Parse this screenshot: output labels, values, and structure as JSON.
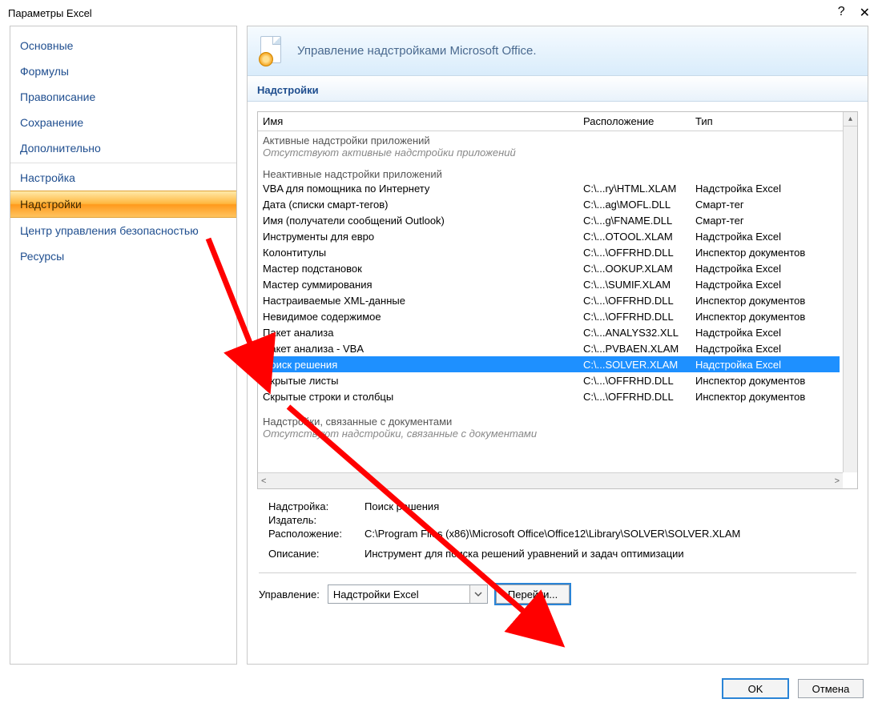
{
  "window": {
    "title": "Параметры Excel"
  },
  "sidebar": {
    "items": [
      {
        "label": "Основные"
      },
      {
        "label": "Формулы"
      },
      {
        "label": "Правописание"
      },
      {
        "label": "Сохранение"
      },
      {
        "label": "Дополнительно"
      }
    ],
    "items2": [
      {
        "label": "Настройка"
      },
      {
        "label": "Надстройки",
        "active": true
      },
      {
        "label": "Центр управления безопасностью"
      },
      {
        "label": "Ресурсы"
      }
    ]
  },
  "banner": {
    "title": "Управление надстройками Microsoft Office."
  },
  "section_title": "Надстройки",
  "columns": {
    "name": "Имя",
    "location": "Расположение",
    "type": "Тип"
  },
  "groups": {
    "active_header": "Активные надстройки приложений",
    "active_empty": "Отсутствуют активные надстройки приложений",
    "inactive_header": "Неактивные надстройки приложений",
    "docrel_header": "Надстройки, связанные с документами",
    "docrel_empty": "Отсутствуют надстройки, связанные с документами"
  },
  "inactive_rows": [
    {
      "name": "VBA для помощника по Интернету",
      "loc": "C:\\...ry\\HTML.XLAM",
      "type": "Надстройка Excel"
    },
    {
      "name": "Дата (списки смарт-тегов)",
      "loc": "C:\\...ag\\MOFL.DLL",
      "type": "Смарт-тег"
    },
    {
      "name": "Имя (получатели сообщений Outlook)",
      "loc": "C:\\...g\\FNAME.DLL",
      "type": "Смарт-тег"
    },
    {
      "name": "Инструменты для евро",
      "loc": "C:\\...OTOOL.XLAM",
      "type": "Надстройка Excel"
    },
    {
      "name": "Колонтитулы",
      "loc": "C:\\...\\OFFRHD.DLL",
      "type": "Инспектор документов"
    },
    {
      "name": "Мастер подстановок",
      "loc": "C:\\...OOKUP.XLAM",
      "type": "Надстройка Excel"
    },
    {
      "name": "Мастер суммирования",
      "loc": "C:\\...\\SUMIF.XLAM",
      "type": "Надстройка Excel"
    },
    {
      "name": "Настраиваемые XML-данные",
      "loc": "C:\\...\\OFFRHD.DLL",
      "type": "Инспектор документов"
    },
    {
      "name": "Невидимое содержимое",
      "loc": "C:\\...\\OFFRHD.DLL",
      "type": "Инспектор документов"
    },
    {
      "name": "Пакет анализа",
      "loc": "C:\\...ANALYS32.XLL",
      "type": "Надстройка Excel"
    },
    {
      "name": "Пакет анализа - VBA",
      "loc": "C:\\...PVBAEN.XLAM",
      "type": "Надстройка Excel"
    },
    {
      "name": "Поиск решения",
      "loc": "C:\\...SOLVER.XLAM",
      "type": "Надстройка Excel",
      "selected": true
    },
    {
      "name": "Скрытые листы",
      "loc": "C:\\...\\OFFRHD.DLL",
      "type": "Инспектор документов"
    },
    {
      "name": "Скрытые строки и столбцы",
      "loc": "C:\\...\\OFFRHD.DLL",
      "type": "Инспектор документов"
    }
  ],
  "details": {
    "addin_label": "Надстройка:",
    "addin_value": "Поиск решения",
    "publisher_label": "Издатель:",
    "publisher_value": "",
    "location_label": "Расположение:",
    "location_value": "C:\\Program Files (x86)\\Microsoft Office\\Office12\\Library\\SOLVER\\SOLVER.XLAM",
    "desc_label": "Описание:",
    "desc_value": "Инструмент для поиска решений уравнений и задач оптимизации"
  },
  "manage": {
    "label": "Управление:",
    "combo_value": "Надстройки Excel",
    "go_button": "Перейти..."
  },
  "footer": {
    "ok": "OK",
    "cancel": "Отмена"
  }
}
